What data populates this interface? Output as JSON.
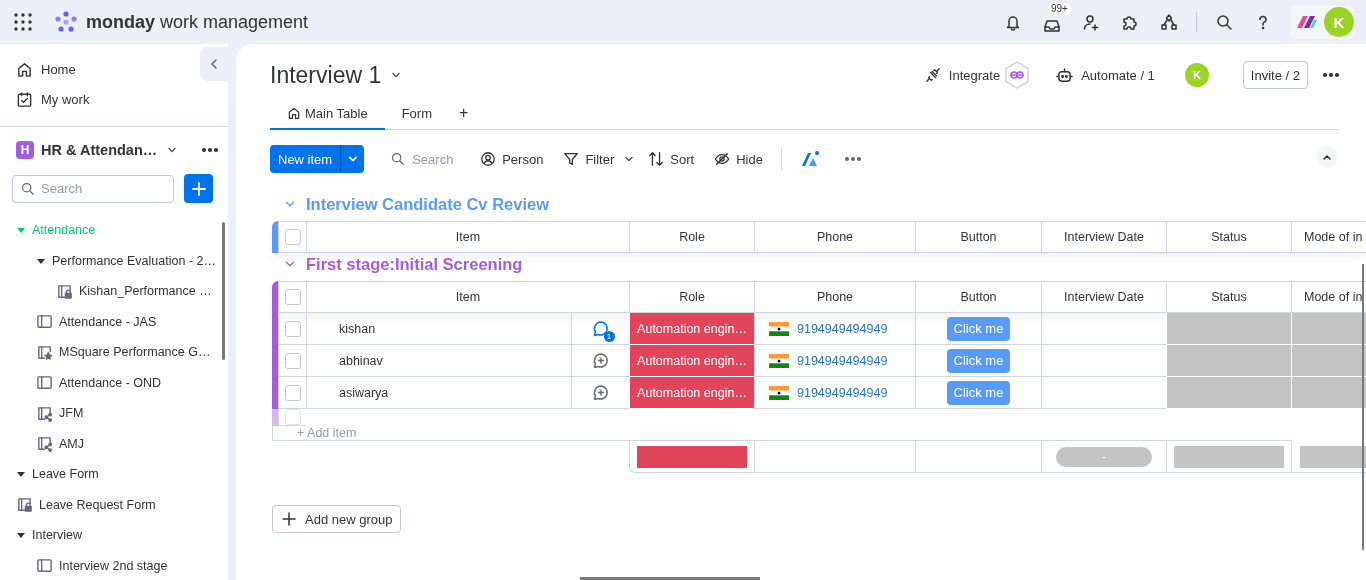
{
  "topbar": {
    "brand": "**monday** work management",
    "inbox_badge": "99+",
    "avatar": "K"
  },
  "sidebar": {
    "nav": [
      {
        "label": "Home",
        "kind": "home"
      },
      {
        "label": "My work",
        "kind": "calendar"
      }
    ],
    "workspace": {
      "badge": "H",
      "name": "HR & Attendan…"
    },
    "search": {
      "placeholder": "Search"
    },
    "tree": [
      {
        "label": "Attendance",
        "kind": "folder",
        "expanded": true,
        "selected": true,
        "children": [
          {
            "label": "Performance Evaluation - 2…",
            "kind": "folder",
            "expanded": true,
            "selected": false,
            "children": [
              {
                "label": "Kishan_Performance …",
                "kind": "locked",
                "selected": false
              }
            ]
          },
          {
            "label": "Attendance - JAS",
            "kind": "board",
            "selected": false
          },
          {
            "label": "MSquare Performance G…",
            "kind": "dashboard",
            "selected": false
          },
          {
            "label": "Attendance - OND",
            "kind": "board",
            "selected": false
          },
          {
            "label": "JFM",
            "kind": "shared",
            "selected": false
          },
          {
            "label": "AMJ",
            "kind": "shared",
            "selected": false
          }
        ]
      },
      {
        "label": "Leave Form",
        "kind": "folder",
        "expanded": true,
        "selected": false
      },
      {
        "label": "Leave Request Form",
        "kind": "locked",
        "selected": false
      },
      {
        "label": "Interview",
        "kind": "folder",
        "expanded": true,
        "selected": false,
        "children": [
          {
            "label": "Interview 2nd stage",
            "kind": "board",
            "selected": false
          }
        ]
      }
    ]
  },
  "board": {
    "title": "Interview 1",
    "integrate": "Integrate",
    "automate": "Automate / 1",
    "member_avatar": "K",
    "invite": "Invite / 2",
    "tabs": [
      {
        "label": "Main Table",
        "kind": "table",
        "selected": true
      },
      {
        "label": "Form",
        "kind": "form",
        "selected": false
      }
    ],
    "add_view": "+",
    "toolbar": {
      "new_item": "New item",
      "search": {
        "placeholder": "Search"
      },
      "person": "Person",
      "filter": "Filter",
      "sort": "Sort",
      "hide": "Hide"
    }
  },
  "groups": [
    {
      "title": "Interview Candidate Cv Review",
      "color": "#579bfc",
      "checked": false,
      "columns": [
        "Item",
        "Role",
        "Phone",
        "Button",
        "Interview Date",
        "Status",
        "Mode of in"
      ]
    },
    {
      "title": "First stage:Initial Screening",
      "color": "#a25ddc",
      "checked": false,
      "columns": [
        "Item",
        "Role",
        "Phone",
        "Button",
        "Interview Date",
        "Status",
        "Mode of in"
      ],
      "rows": [
        {
          "item": "kishan",
          "checked": false,
          "comments": "1",
          "role": "Automation engin…",
          "phone": "9194949494949",
          "button": "Click me"
        },
        {
          "item": "abhinav",
          "checked": false,
          "role": "Automation engin…",
          "phone": "9194949494949",
          "button": "Click me"
        },
        {
          "item": "asiwarya",
          "checked": false,
          "role": "Automation engin…",
          "phone": "9194949494949",
          "button": "Click me"
        }
      ],
      "add_item": {
        "label": "+ Add item",
        "checked": false
      },
      "summary": {
        "date": "-"
      }
    }
  ],
  "add_group": "Add new group"
}
